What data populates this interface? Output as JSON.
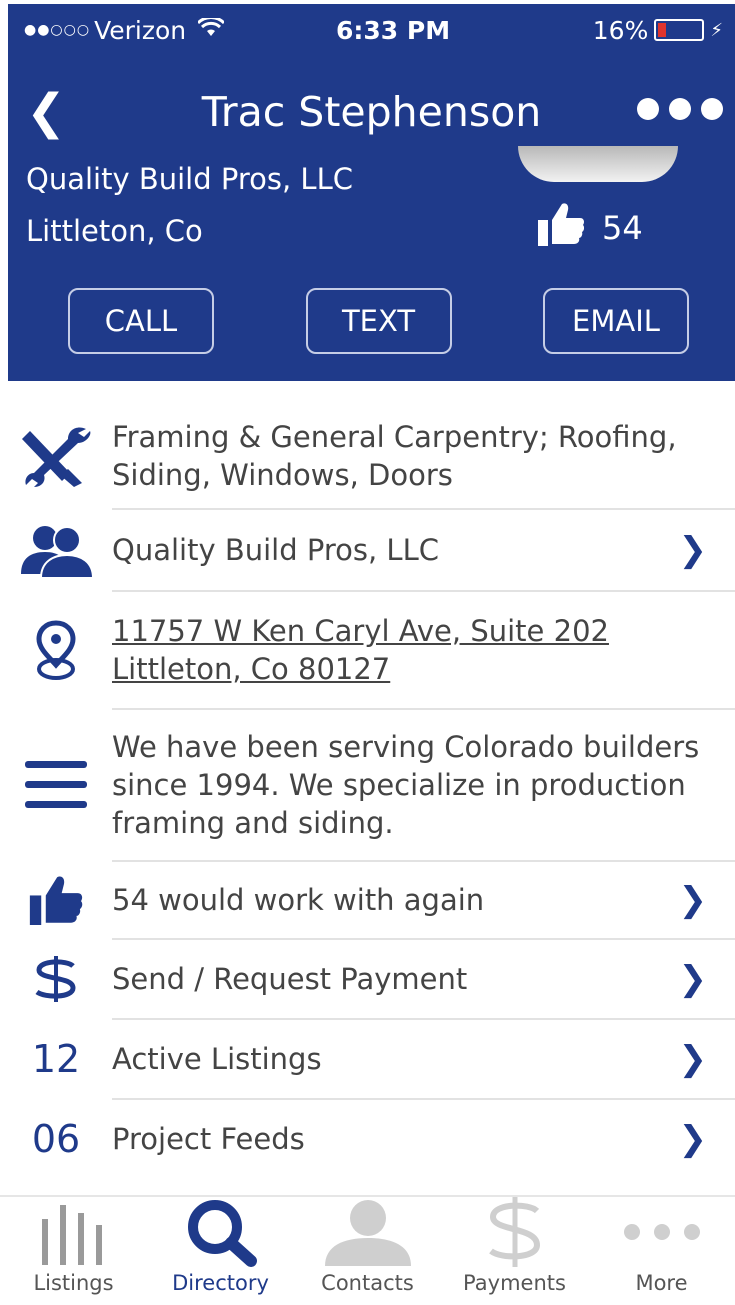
{
  "status_bar": {
    "signal_dots": "●●○○○",
    "carrier": "Verizon",
    "time": "6:33 PM",
    "battery": "16%"
  },
  "header": {
    "title": "Trac Stephenson",
    "company": "Quality Build Pros, LLC",
    "location": "Littleton, Co",
    "like_count": "54",
    "background_color": "#1f3a8a"
  },
  "actions": {
    "call": "CALL",
    "text": "TEXT",
    "email": "EMAIL"
  },
  "details": {
    "trades": "Framing & General Carpentry; Roofing, Siding, Windows, Doors",
    "company": "Quality Build Pros, LLC",
    "address_line1": "11757 W Ken Caryl Ave, Suite 202",
    "address_line2": "Littleton, Co 80127",
    "description": "We have been serving Colorado builders since 1994. We specialize in production framing and siding.",
    "recommendations": "54 would work with again",
    "payment": "Send / Request Payment",
    "listings_count": "12",
    "listings_label": "Active Listings",
    "feeds_count": "06",
    "feeds_label": "Project Feeds"
  },
  "tabbar": {
    "active": "Directory",
    "tabs": [
      {
        "label": "Listings",
        "icon": "bars-icon"
      },
      {
        "label": "Directory",
        "icon": "search-icon"
      },
      {
        "label": "Contacts",
        "icon": "person-icon"
      },
      {
        "label": "Payments",
        "icon": "dollar-icon"
      },
      {
        "label": "More",
        "icon": "more-dots-icon"
      }
    ]
  },
  "colors": {
    "accent": "#1f3a8a",
    "battery_low": "#e0342c"
  }
}
